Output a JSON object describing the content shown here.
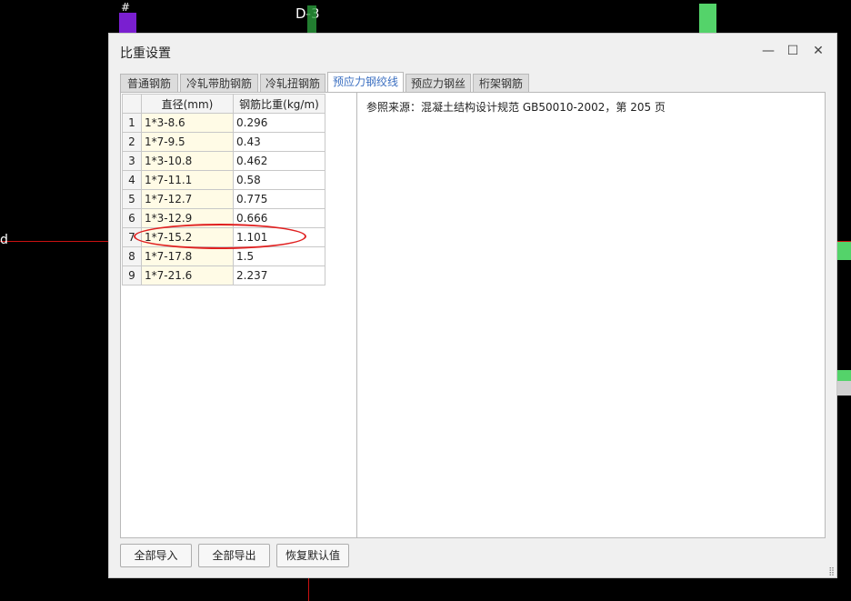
{
  "background": {
    "label_left": "D-3",
    "edge_glyph": "d",
    "colors": {
      "canvas": "#000000",
      "purple": "#7a1fd0",
      "green": "#54d36a",
      "red_line": "#cc1111",
      "gray": "#d0d0d0"
    }
  },
  "dialog": {
    "title": "比重设置",
    "window_controls": {
      "minimize": "—",
      "maximize": "☐",
      "close": "✕"
    },
    "tabs": [
      {
        "label": "普通钢筋",
        "active": false
      },
      {
        "label": "冷轧带肋钢筋",
        "active": false
      },
      {
        "label": "冷轧扭钢筋",
        "active": false
      },
      {
        "label": "预应力钢绞线",
        "active": true
      },
      {
        "label": "预应力钢丝",
        "active": false
      },
      {
        "label": "桁架钢筋",
        "active": false
      }
    ],
    "table": {
      "headers": [
        "直径(mm)",
        "钢筋比重(kg/m)"
      ],
      "rows": [
        {
          "index": "1",
          "diameter": "1*3-8.6",
          "weight": "0.296"
        },
        {
          "index": "2",
          "diameter": "1*7-9.5",
          "weight": "0.43"
        },
        {
          "index": "3",
          "diameter": "1*3-10.8",
          "weight": "0.462"
        },
        {
          "index": "4",
          "diameter": "1*7-11.1",
          "weight": "0.58"
        },
        {
          "index": "5",
          "diameter": "1*7-12.7",
          "weight": "0.775"
        },
        {
          "index": "6",
          "diameter": "1*3-12.9",
          "weight": "0.666"
        },
        {
          "index": "7",
          "diameter": "1*7-15.2",
          "weight": "1.101"
        },
        {
          "index": "8",
          "diameter": "1*7-17.8",
          "weight": "1.5"
        },
        {
          "index": "9",
          "diameter": "1*7-21.6",
          "weight": "2.237"
        }
      ]
    },
    "reference_note": "参照来源：混凝土结构设计规范 GB50010-2002，第 205 页",
    "buttons": {
      "import_all": "全部导入",
      "export_all": "全部导出",
      "restore_defaults": "恢复默认值"
    },
    "highlight_color": "#e02020"
  }
}
